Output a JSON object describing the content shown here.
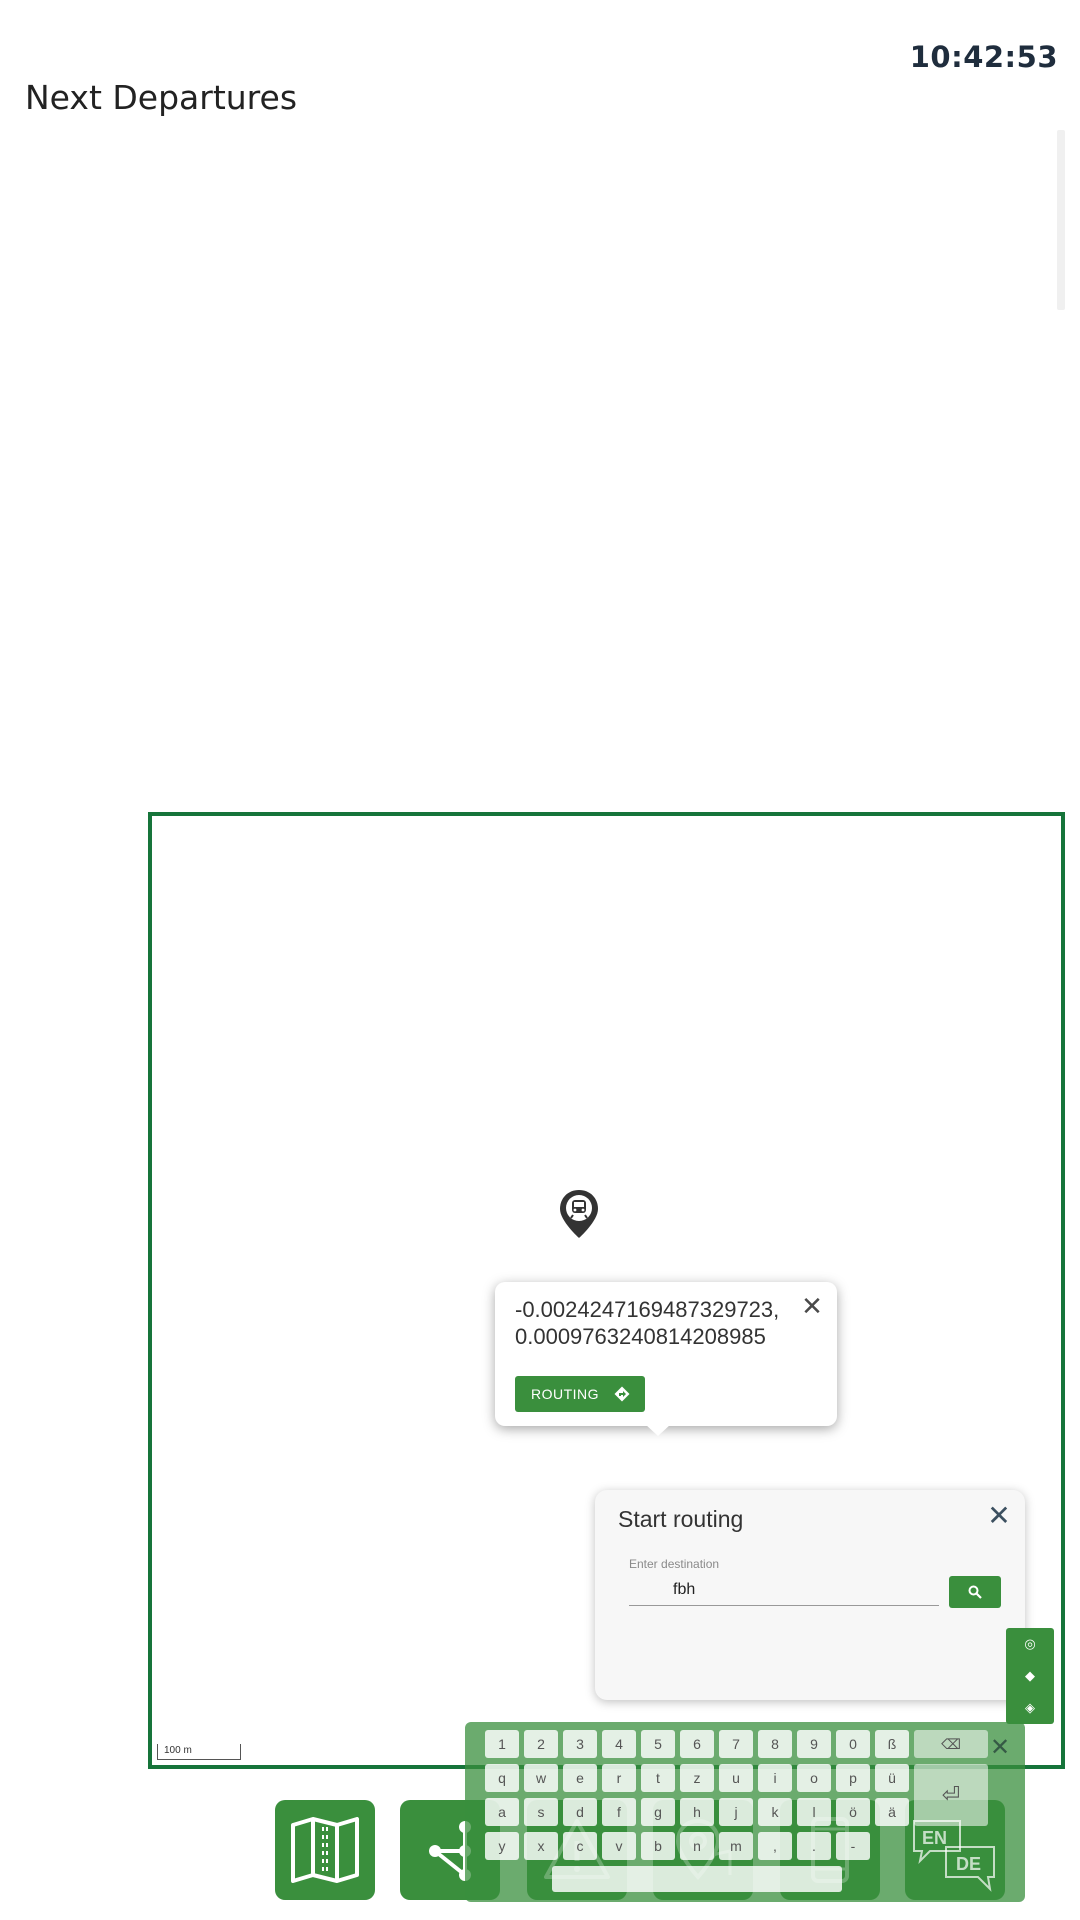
{
  "header": {
    "clock": "10:42:53",
    "title": "Next Departures"
  },
  "map": {
    "popup": {
      "coords_line1": "-0.0024247169487329723,",
      "coords_line2": "0.0009763240814208985",
      "routing_button": "ROUTING"
    },
    "scale": "100 m"
  },
  "routing_panel": {
    "title": "Start routing",
    "destination_label": "Enter destination",
    "destination_value": "fbh"
  },
  "keyboard": {
    "row1": [
      "1",
      "2",
      "3",
      "4",
      "5",
      "6",
      "7",
      "8",
      "9",
      "0",
      "ß"
    ],
    "row2": [
      "q",
      "w",
      "e",
      "r",
      "t",
      "z",
      "u",
      "i",
      "o",
      "p",
      "ü"
    ],
    "row3": [
      "a",
      "s",
      "d",
      "f",
      "g",
      "h",
      "j",
      "k",
      "l",
      "ö",
      "ä"
    ],
    "row4": [
      "y",
      "x",
      "c",
      "v",
      "b",
      "n",
      "m",
      ",",
      ".",
      "-"
    ],
    "backspace": "⌫",
    "enter": "⏎",
    "languages": [
      "EN",
      "DE"
    ]
  },
  "colors": {
    "brand_green": "#3a8f3d",
    "frame_green": "#16743a"
  }
}
